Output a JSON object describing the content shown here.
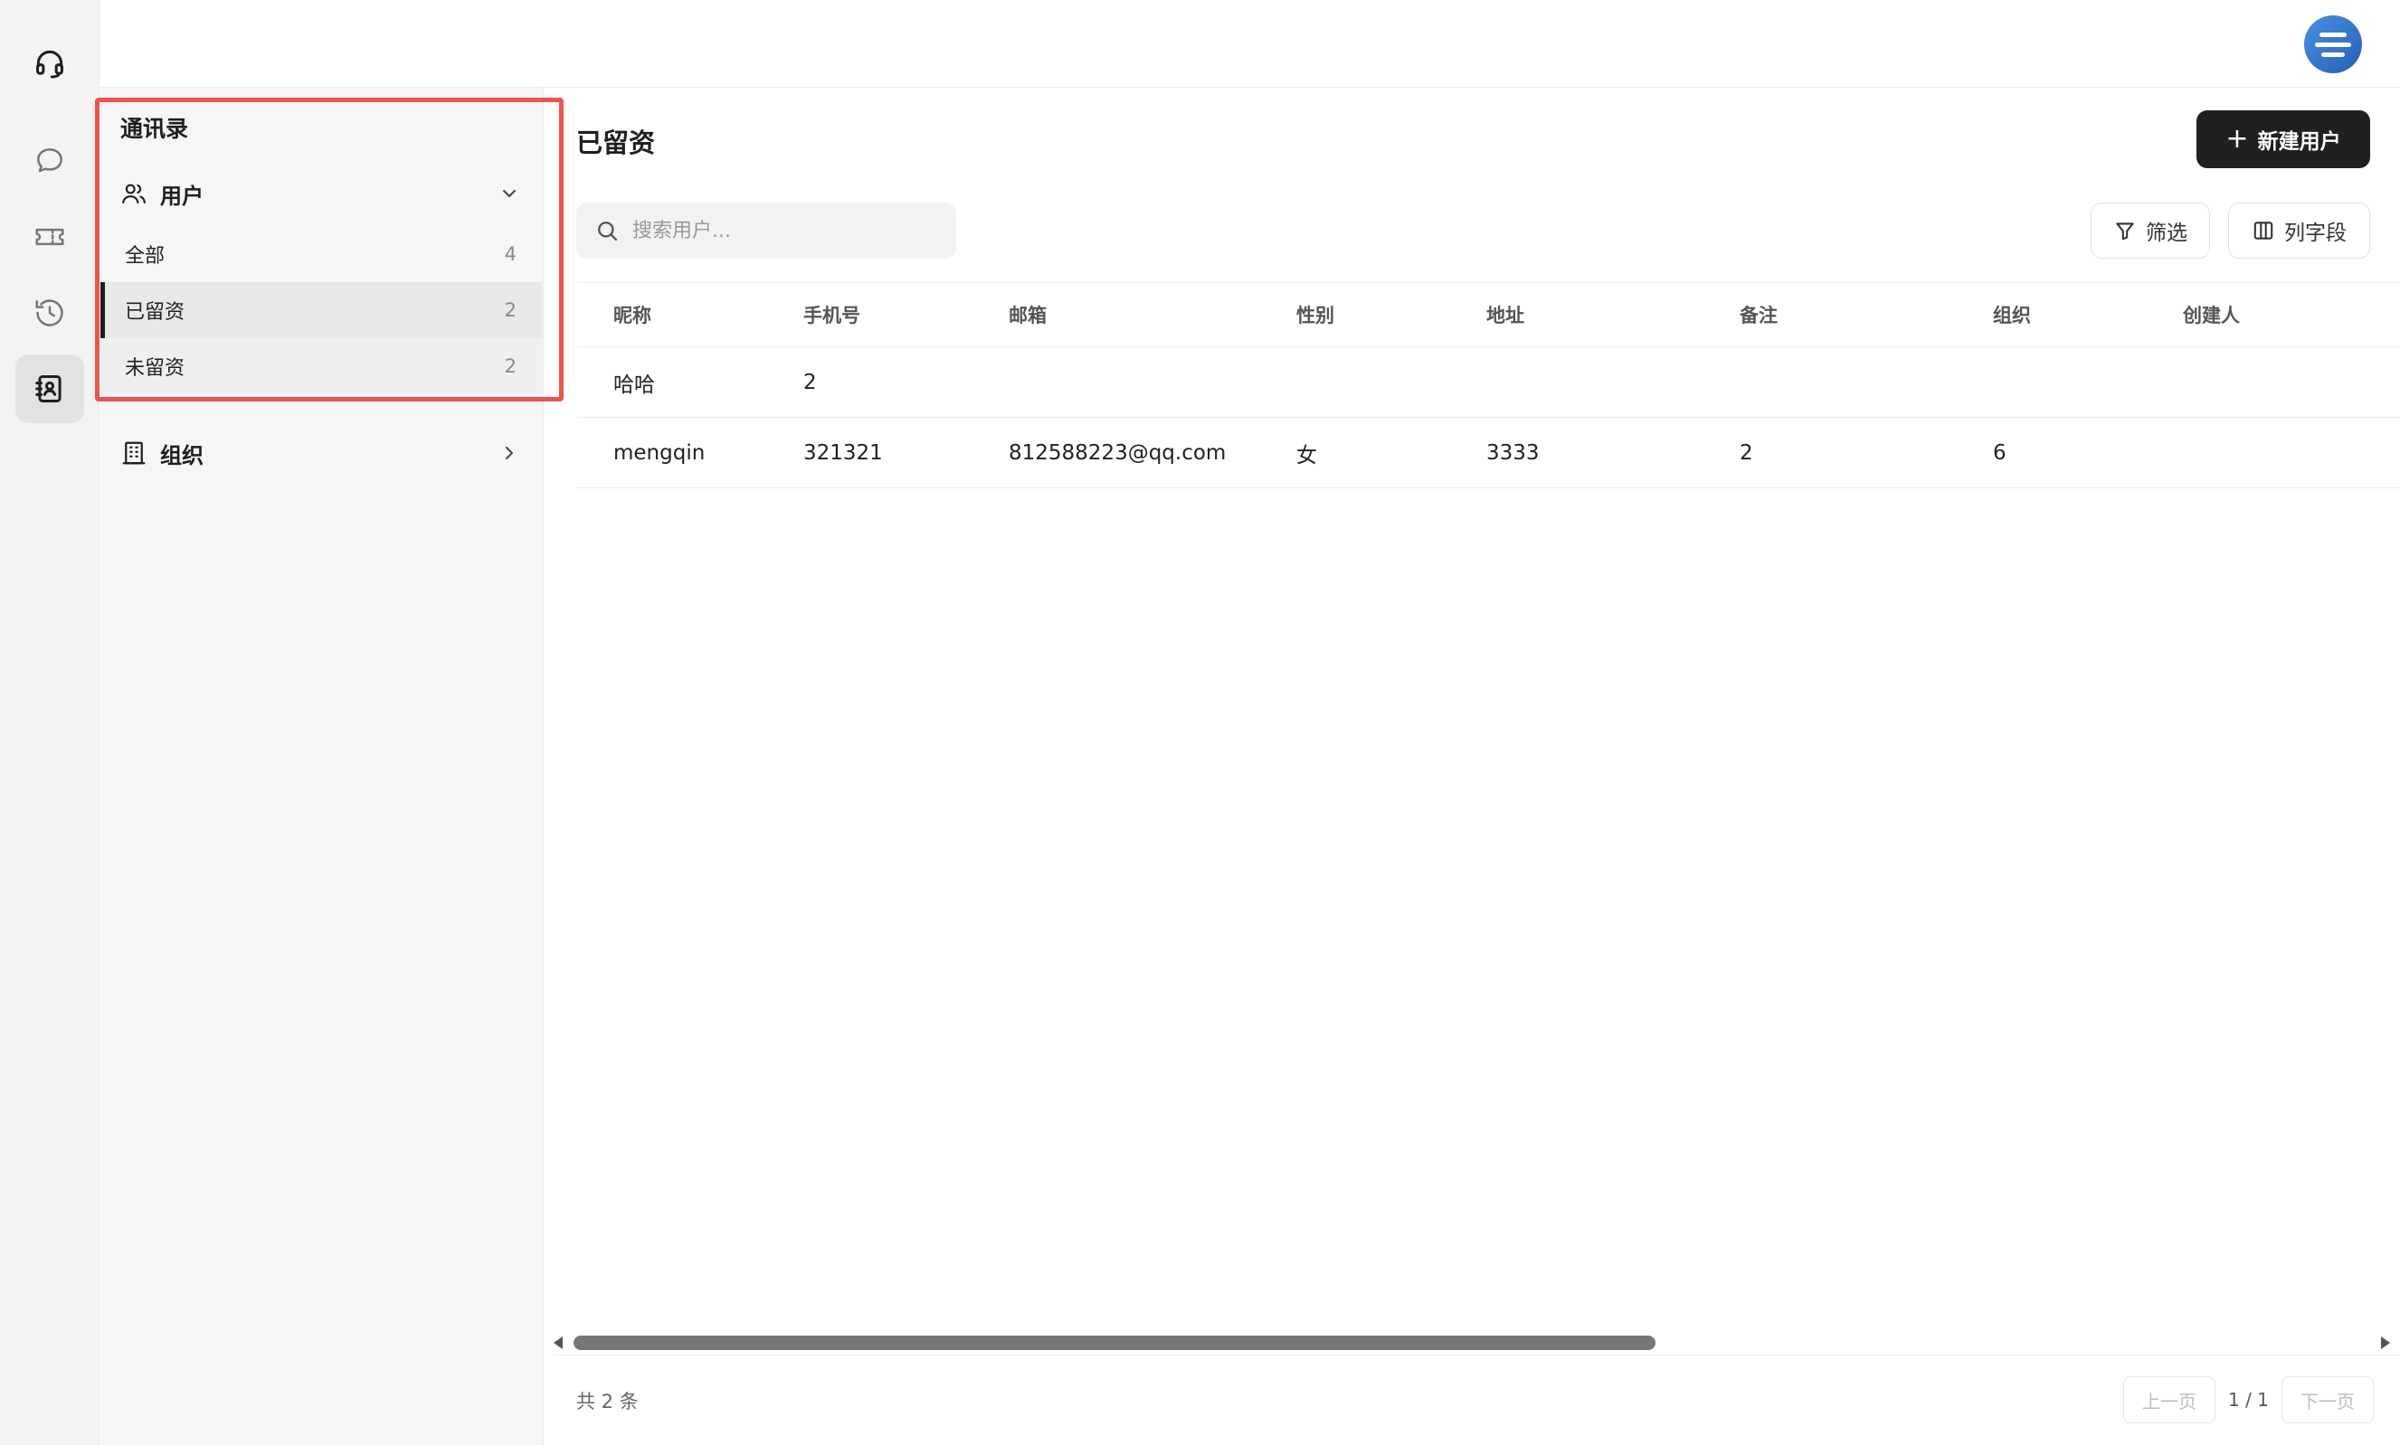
{
  "rail": {
    "items": [
      {
        "name": "support-headset-icon"
      },
      {
        "name": "chat-icon"
      },
      {
        "name": "ticket-icon"
      },
      {
        "name": "history-icon"
      },
      {
        "name": "contacts-icon"
      }
    ]
  },
  "sidebar": {
    "title": "通讯录",
    "users_group": {
      "label": "用户"
    },
    "items": [
      {
        "label": "全部",
        "count": "4"
      },
      {
        "label": "已留资",
        "count": "2"
      },
      {
        "label": "未留资",
        "count": "2"
      }
    ],
    "org_group": {
      "label": "组织"
    }
  },
  "main": {
    "title": "已留资",
    "new_button": "新建用户",
    "search_placeholder": "搜索用户...",
    "filter_button": "筛选",
    "columns_button": "列字段"
  },
  "table": {
    "headers": [
      "昵称",
      "手机号",
      "邮箱",
      "性别",
      "地址",
      "备注",
      "组织",
      "创建人"
    ],
    "rows": [
      [
        "哈哈",
        "2",
        "",
        "",
        "",
        "",
        "",
        ""
      ],
      [
        "mengqin",
        "321321",
        "812588223@qq.com",
        "女",
        "3333",
        "2",
        "6",
        ""
      ]
    ]
  },
  "footer": {
    "total": "共 2 条",
    "prev": "上一页",
    "page_info": "1 / 1",
    "next": "下一页"
  },
  "colors": {
    "accent_dark": "#202020",
    "highlight_border": "#ef5350",
    "avatar_blue": "#2461b8"
  }
}
